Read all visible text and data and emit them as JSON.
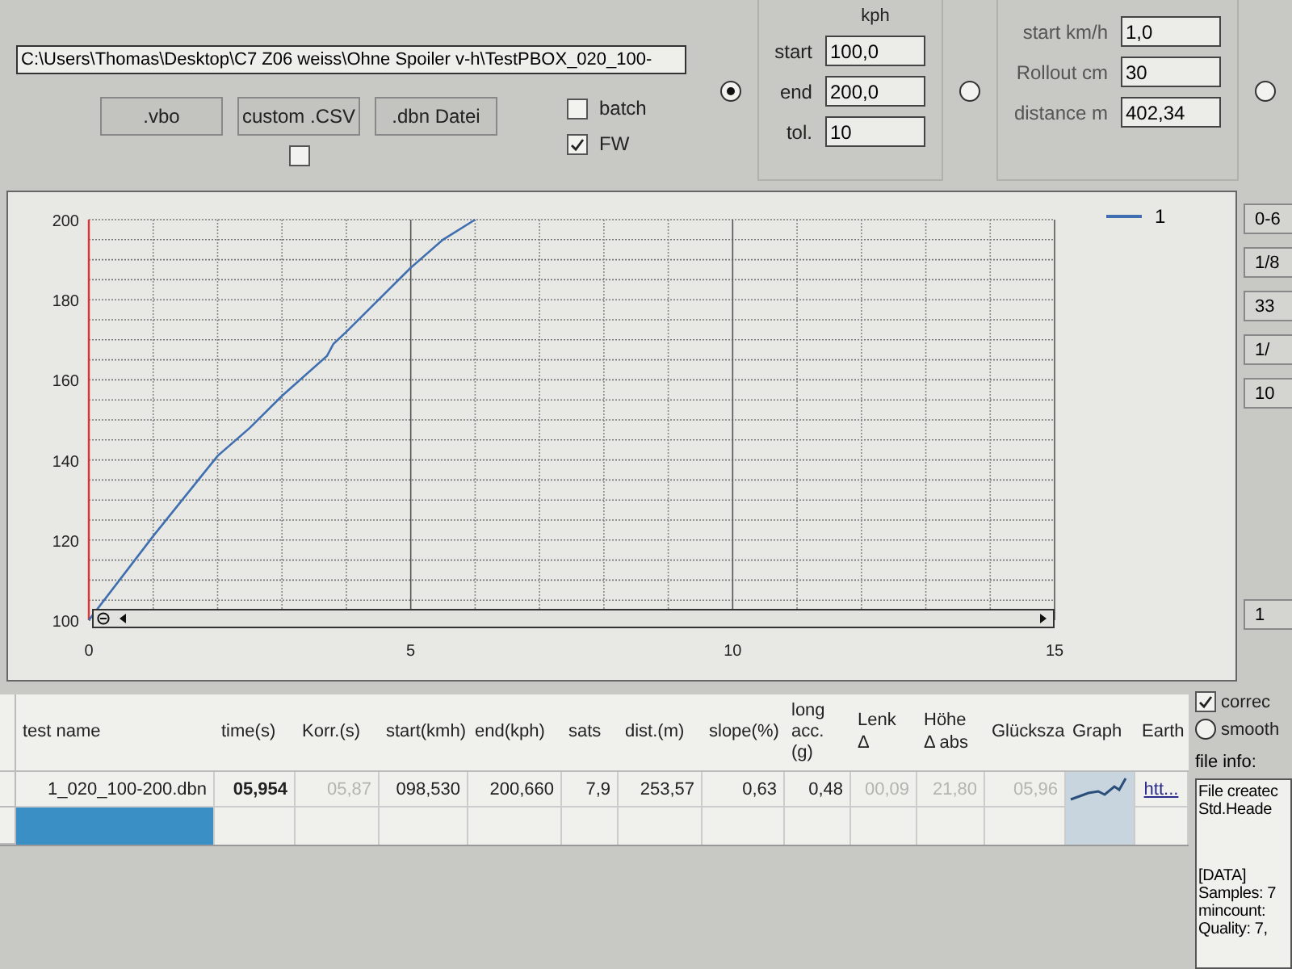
{
  "path_field": {
    "value": "C:\\Users\\Thomas\\Desktop\\C7 Z06 weiss\\Ohne Spoiler v-h\\TestPBOX_020_100-"
  },
  "file_buttons": [
    ".vbo",
    "custom .CSV",
    ".dbn Datei"
  ],
  "custom_checkbox": {
    "checked": false
  },
  "options": [
    {
      "label": "batch",
      "checked": false
    },
    {
      "label": "FW",
      "checked": true
    }
  ],
  "mode_radios": [
    {
      "selected": true
    },
    {
      "selected": false
    },
    {
      "selected": false
    }
  ],
  "kph_group": {
    "title": "kph",
    "fields": [
      {
        "label": "start",
        "value": "100,0"
      },
      {
        "label": "end",
        "value": "200,0"
      },
      {
        "label": "tol.",
        "value": "10"
      }
    ]
  },
  "distance_group": {
    "fields": [
      {
        "label": "start km/h",
        "value": "1,0"
      },
      {
        "label": "Rollout cm",
        "value": "30"
      },
      {
        "label": "distance m",
        "value": "402,34"
      }
    ]
  },
  "chart": {
    "chart_data": {
      "type": "line",
      "grid": true,
      "xlim": [
        0,
        15
      ],
      "ylim": [
        100,
        200
      ],
      "xticks": [
        0,
        5,
        10,
        15
      ],
      "yticks": [
        100,
        120,
        140,
        160,
        180,
        200
      ],
      "series": [
        {
          "name": "1",
          "color": "#3f6fb0",
          "x": [
            0,
            1,
            2,
            2.5,
            3,
            3.7,
            3.8,
            4,
            5,
            5.5,
            6
          ],
          "values": [
            100,
            121,
            141,
            148,
            156,
            166,
            169,
            172,
            188,
            195,
            200
          ]
        }
      ]
    }
  },
  "side_buttons": [
    "0-6",
    "1/8",
    "33",
    "1/",
    "10",
    "1"
  ],
  "table": {
    "columns": [
      "test name",
      "time(s)",
      "Korr.(s)",
      "start(kmh)",
      "end(kph)",
      "sats",
      "dist.(m)",
      "slope(%)",
      "long acc.(g)",
      "Lenk Δ",
      "Höhe Δ abs",
      "Glücksza",
      "Graph",
      "Earth"
    ],
    "rows": [
      {
        "cells": [
          {
            "kind": "text",
            "text": "1_020_100-200.dbn",
            "disabled": false,
            "bold": false
          },
          {
            "kind": "text",
            "text": "05,954",
            "disabled": false,
            "bold": true
          },
          {
            "kind": "text",
            "text": "05,87",
            "disabled": true,
            "bold": false
          },
          {
            "kind": "text",
            "text": "098,530",
            "disabled": false,
            "bold": false
          },
          {
            "kind": "text",
            "text": "200,660",
            "disabled": false,
            "bold": false
          },
          {
            "kind": "text",
            "text": "7,9",
            "disabled": false,
            "bold": false
          },
          {
            "kind": "text",
            "text": "253,57",
            "disabled": false,
            "bold": false
          },
          {
            "kind": "text",
            "text": "0,63",
            "disabled": false,
            "bold": false
          },
          {
            "kind": "text",
            "text": "0,48",
            "disabled": false,
            "bold": false
          },
          {
            "kind": "text",
            "text": "00,09",
            "disabled": true,
            "bold": false
          },
          {
            "kind": "text",
            "text": "21,80",
            "disabled": true,
            "bold": false
          },
          {
            "kind": "text",
            "text": "05,96",
            "disabled": true,
            "bold": false
          },
          {
            "kind": "sparkline"
          },
          {
            "kind": "link",
            "text": "htt..."
          }
        ]
      }
    ],
    "new_row": {
      "selected": true
    }
  },
  "side_options": [
    {
      "kind": "checkbox",
      "label": "correc",
      "checked": true
    },
    {
      "kind": "radio",
      "label": "smooth",
      "checked": false
    }
  ],
  "file_info": {
    "label": "file info:",
    "lines": [
      "File createc",
      "Std.Heade",
      "[DATA]",
      "Samples: 7",
      "mincount:",
      "Quality: 7,"
    ]
  }
}
